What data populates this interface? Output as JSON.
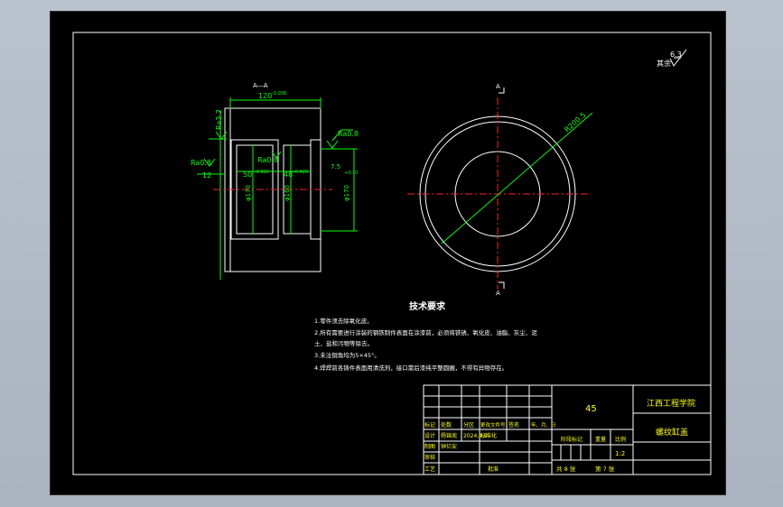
{
  "drawing": {
    "roughness_symbol": "6.3",
    "roughness_rest": "其余",
    "section_label": "A—A",
    "section_marks": [
      "A",
      "A"
    ],
    "dims": {
      "width": "120",
      "width_tol": "-0.038",
      "ra32": "Ra3.2",
      "ra08_left": "Ra0.8",
      "ra08_right": "Ra0.8",
      "ra08_mid": "Ra0.8",
      "d50": "50",
      "d50_tol": "-0.025",
      "d48": "48",
      "d48_tol": "-0.025",
      "d12": "12",
      "ch": "7.5",
      "ch_tol": "+0.10",
      "phi170": "φ170",
      "phi160": "φ160",
      "phi70": "φ170",
      "r_circle": "R200.5"
    },
    "colors": {
      "outline": "#ffffff",
      "dimension": "#00ff00",
      "centerline": "#ff2020"
    }
  },
  "tech_requirements": {
    "title": "技术要求",
    "items": [
      "1.零件须去除氧化皮。",
      "2.所有需要进行涂装的钢铁制件表面在涂漆前，必须将铁锈、氧化皮、油脂、灰尘、泥",
      "  土、盐和污物等除去。",
      "3.未注倒角均为5×45°。",
      "4.焊焊前各铸件表面用清洗剂，接口需后漆纯平整圆圈，不得有异物存在。"
    ]
  },
  "title_block": {
    "material": "45",
    "school": "江西工程学院",
    "part_name": "螺纹缸盖",
    "scale": "1:2",
    "sheet_total": "共 8 张",
    "sheet_no": "第 7 张",
    "header_row": [
      "标记",
      "处数",
      "分区",
      "更改文件号",
      "签名",
      "年、月、日"
    ],
    "designer_label": "设计",
    "designer_name": "杨锦淞",
    "date": "2024.4.9",
    "std_label": "标准化",
    "draw_label": "制图",
    "drawer_name": "钟亿安",
    "check_label": "审核",
    "process_label": "工艺",
    "approve_label": "批准",
    "stage_label": "阶段标记",
    "weight_label": "重量",
    "scale_label": "比例"
  }
}
